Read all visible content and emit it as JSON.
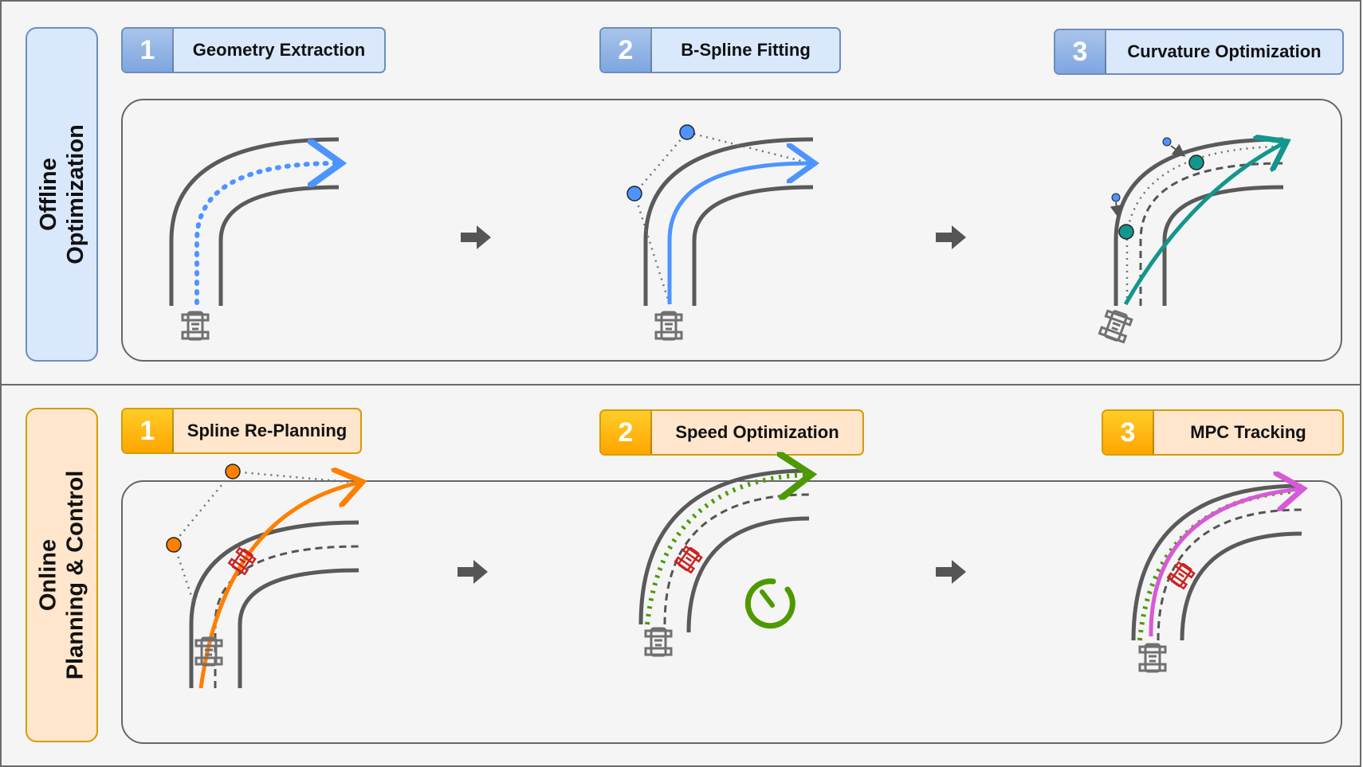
{
  "offline": {
    "title": "Offline\nOptimization",
    "steps": [
      {
        "num": "1",
        "label": "Geometry Extraction"
      },
      {
        "num": "2",
        "label": "B-Spline Fitting"
      },
      {
        "num": "3",
        "label": "Curvature Optimization"
      }
    ]
  },
  "online": {
    "title": "Online\nPlanning & Control",
    "steps": [
      {
        "num": "1",
        "label": "Spline Re-Planning"
      },
      {
        "num": "2",
        "label": "Speed Optimization"
      },
      {
        "num": "3",
        "label": "MPC Tracking"
      }
    ]
  },
  "colors": {
    "blue_step": "#dae8fc",
    "blue_num": "#7ea6e0",
    "blue_border": "#6c8ebf",
    "orange_step": "#ffe6cc",
    "orange_num": "#ffa500",
    "orange_border": "#d79b00",
    "track": "#5a5a5a",
    "geometry_path": "#4d94ff",
    "bspline_path": "#4d94ff",
    "optimized_path": "#13968c",
    "replanning_path": "#ff7f00",
    "speed_path": "#4d9900",
    "mpc_path": "#d65ad6",
    "car_outline": "#707070",
    "ego_car": "#cc2222"
  },
  "icons": [
    "race-car-icon",
    "right-arrow-icon",
    "control-point-icon",
    "stopwatch-icon"
  ]
}
